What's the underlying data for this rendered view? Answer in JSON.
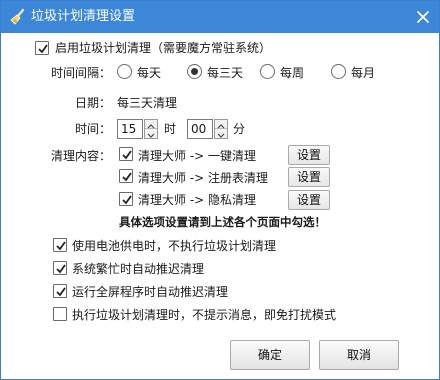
{
  "window": {
    "title": "垃圾计划清理设置",
    "icon": "broom-icon",
    "close_icon": "close-icon",
    "titlebar_color": "#3c87d8"
  },
  "enable": {
    "label": "启用垃圾计划清理（需要魔方常驻系统）",
    "checked": true
  },
  "interval": {
    "label": "时间间隔：",
    "options": [
      {
        "label": "每天",
        "selected": false
      },
      {
        "label": "每三天",
        "selected": true
      },
      {
        "label": "每周",
        "selected": false
      },
      {
        "label": "每月",
        "selected": false
      }
    ]
  },
  "date": {
    "label": "日期：",
    "value": "每三天清理"
  },
  "time": {
    "label": "时间：",
    "hour": "15",
    "hour_unit": "时",
    "minute": "00",
    "minute_unit": "分"
  },
  "clean": {
    "label": "清理内容：",
    "items": [
      {
        "label": "清理大师 -> 一键清理",
        "checked": true,
        "button": "设置"
      },
      {
        "label": "清理大师 -> 注册表清理",
        "checked": true,
        "button": "设置"
      },
      {
        "label": "清理大师 -> 隐私清理",
        "checked": true,
        "button": "设置"
      }
    ],
    "note": "具体选项设置请到上述各个页面中勾选！"
  },
  "options": [
    {
      "label": "使用电池供电时，不执行垃圾计划清理",
      "checked": true
    },
    {
      "label": "系统繁忙时自动推迟清理",
      "checked": true
    },
    {
      "label": "运行全屏程序时自动推迟清理",
      "checked": true
    },
    {
      "label": "执行垃圾计划清理时，不提示消息，即免打扰模式",
      "checked": false
    }
  ],
  "buttons": {
    "ok": "确定",
    "cancel": "取消"
  }
}
